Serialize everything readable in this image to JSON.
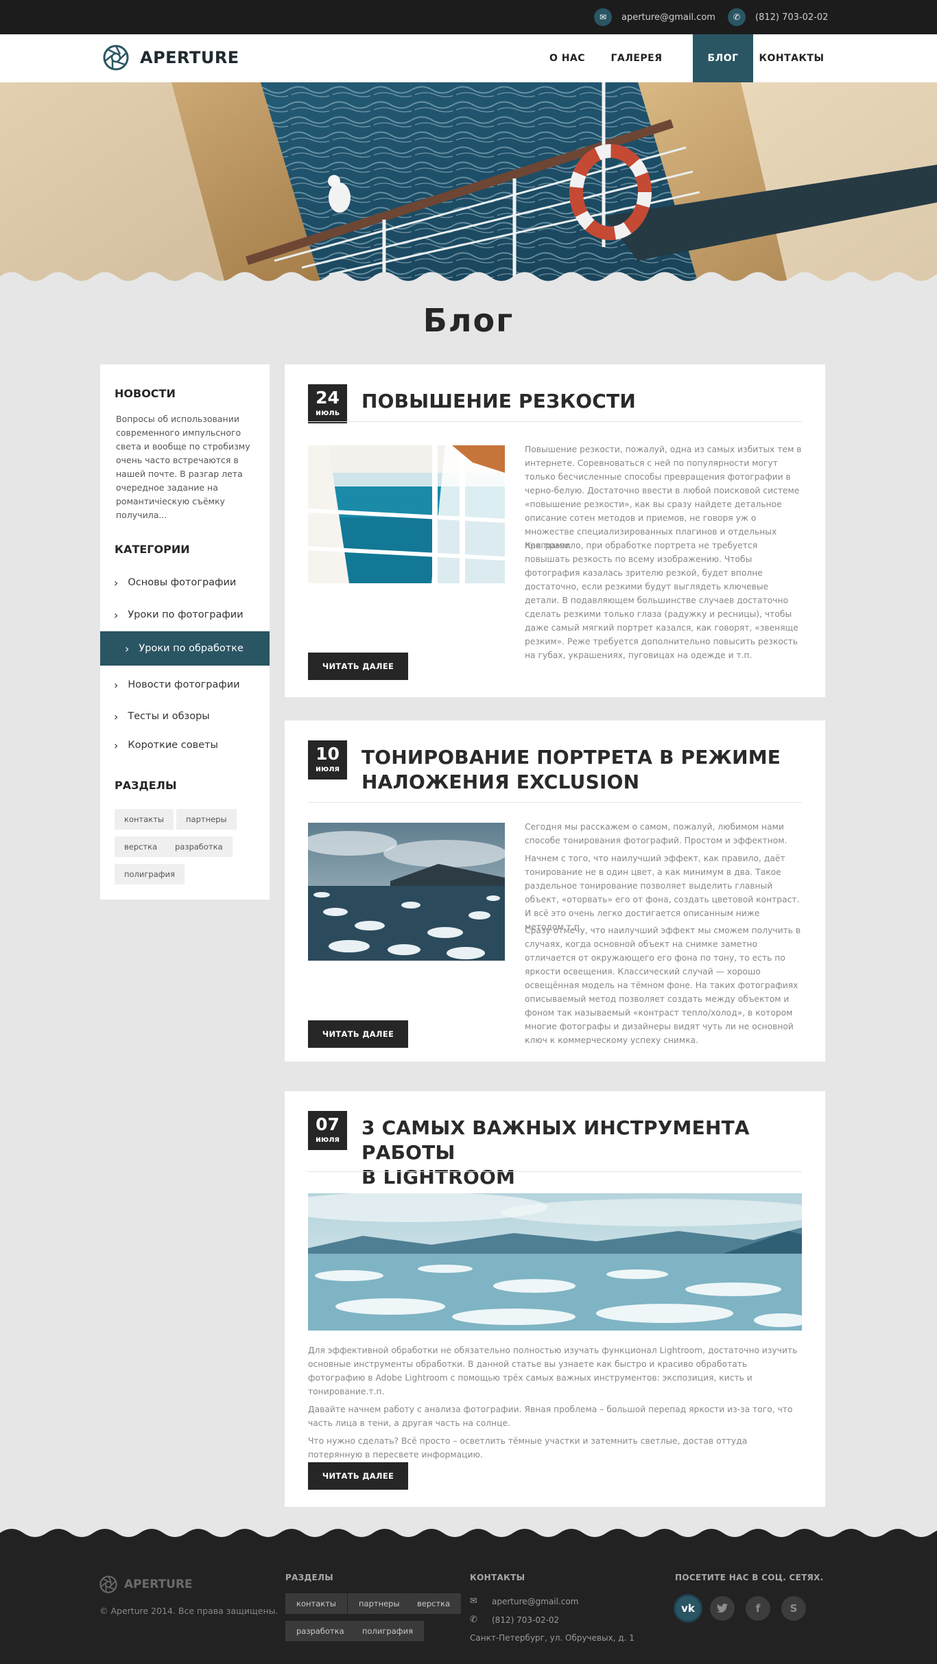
{
  "topbar": {
    "email": "aperture@gmail.com",
    "phone": "(812) 703-02-02"
  },
  "header": {
    "logo": "APERTURE",
    "nav": [
      {
        "label": "О НАС"
      },
      {
        "label": "ГАЛЕРЕЯ"
      },
      {
        "label": "БЛОГ"
      },
      {
        "label": "КОНТАКТЫ"
      }
    ],
    "active_nav": "БЛОГ"
  },
  "page": {
    "title": "Блог"
  },
  "sidebar": {
    "news_heading": "НОВОСТИ",
    "news_text": "Вопросы об использовании современного импульсного света и вообще по стробизму очень часто встречаются в нашей почте. В разгар лета очередное задание на романтичiескую съёмку получила...",
    "categories_heading": "КАТЕГОРИИ",
    "categories": [
      {
        "label": "Основы фотографии"
      },
      {
        "label": "Уроки по фотографии"
      },
      {
        "label": "Уроки по обработке"
      },
      {
        "label": "Новости фотографии"
      },
      {
        "label": "Тесты и обзоры"
      },
      {
        "label": "Короткие советы"
      }
    ],
    "active_category": "Уроки по обработке",
    "sections_heading": "РАЗДЕЛЫ",
    "tags": [
      "контакты",
      "партнеры",
      "верстка",
      "разработка",
      "полиграфия"
    ]
  },
  "posts": [
    {
      "day": "24",
      "month": "июль",
      "title": "ПОВЫШЕНИЕ РЕЗКОСТИ",
      "paragraphs": [
        "Повышение резкости, пожалуй, одна из самых избитых тем в интернете. Соревноваться с ней по популярности могут только бесчисленные способы превращения фотографии в черно-белую. Достаточно ввести в любой поисковой системе «повышение резкости», как вы сразу найдете детальное описание сотен методов и приемов, не говоря уж о множестве специализированных плагинов и отдельных программ.",
        "Как правило, при обработке портрета не требуется повышать резкость по всему изображению. Чтобы фотография казалась зрителю резкой, будет вполне достаточно, если резкими будут выглядеть ключевые детали. В подавляющем большинстве случаев достаточно сделать резкими только глаза (радужку и ресницы), чтобы даже самый мягкий портрет казался, как говорят, «звенящe резким». Реже требуется дополнительно повысить резкость на губах, украшениях, пуговицах на одежде и т.п."
      ],
      "button": "ЧИТАТЬ ДАЛЕЕ"
    },
    {
      "day": "10",
      "month": "июля",
      "title_line1": "ТОНИРОВАНИЕ ПОРТРЕТА В РЕЖИМЕ",
      "title_line2": "НАЛОЖЕНИЯ EXCLUSION",
      "paragraphs": [
        "Сегодня мы расскажем о самом, пожалуй, любимом нами способе тонирования фотографий. Простом и эффектном.",
        "Начнем с того, что наилучший эффект, как правило, даёт тонирование не в один цвет, а как минимум в два. Такое раздельное тонирование позволяет выделить главный объект, «оторвать» его от фона, создать цветовой контраст. И всё это очень легко достигается описанным ниже методом.т.п.",
        "Сразу отмечу, что наилучший эффект мы сможем получить в случаях, когда основной объект на снимке заметно отличается от окружающего его фона по тону, то есть по яркости освещения. Классический случай — хорошо освещённая модель на тёмном фоне. На таких фотографиях описываемый метод позволяет создать между объектом и фоном так называемый «контраст тепло/холод», в котором многие фотографы и дизайнеры видят чуть ли не основной ключ к коммерческому успеху снимка."
      ],
      "button": "ЧИТАТЬ ДАЛЕЕ"
    },
    {
      "day": "07",
      "month": "июля",
      "title_line1": "3 САМЫХ ВАЖНЫХ ИНСТРУМЕНТА РАБОТЫ",
      "title_line2": "В LIGHTROOM",
      "paragraphs": [
        "Для эффективной обработки не обязательно полностью изучать функционал Lightroom, достаточно изучить основные инструменты обработки. В данной статье вы узнаете как быстро и красиво обработать фотографию в Adobe Lightroom с помощью трёх самых важных инструментов: экспозиция, кисть и тонирование.т.п.",
        "Давайте начнем работу с анализа фотографии. Явная проблема – большой перепад яркости из-за того, что часть лица в тени, а другая часть на солнце.",
        "Что нужно сделать? Всё просто – осветлить тёмные участки и затемнить светлые, достав оттуда потерянную в пересвете информацию."
      ],
      "button": "ЧИТАТЬ ДАЛЕЕ"
    }
  ],
  "footer": {
    "logo": "APERTURE",
    "copyright": "© Aperture 2014. Все права защищены.",
    "sections_heading": "РАЗДЕЛЫ",
    "tags": [
      "контакты",
      "партнеры",
      "верстка",
      "разработка",
      "полиграфия"
    ],
    "contacts_heading": "КОНТАКТЫ",
    "email": "aperture@gmail.com",
    "phone": "(812) 703-02-02",
    "address": "Санкт-Петербург, ул. Обручевых, д. 1",
    "social_heading": "ПОСЕТИТЕ НАС В СОЦ. СЕТЯХ.",
    "social": [
      "вк",
      "twitter",
      "facebook",
      "skype"
    ]
  },
  "colors": {
    "accent": "#2a5563",
    "dark": "#262626",
    "background": "#e6e6e6"
  }
}
